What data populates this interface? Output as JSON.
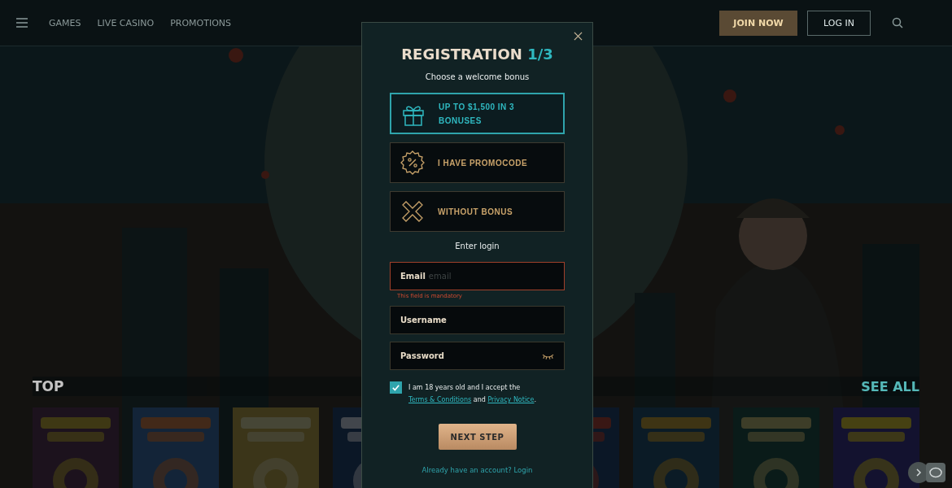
{
  "header": {
    "nav": [
      "GAMES",
      "LIVE CASINO",
      "PROMOTIONS"
    ],
    "join_button": "JOIN NOW",
    "login_button": "LOG IN"
  },
  "top_section": {
    "title": "TOP",
    "see_all": "SEE ALL"
  },
  "modal": {
    "title": "REGISTRATION",
    "step": "1/3",
    "subtitle": "Choose a welcome bonus",
    "bonus_options": [
      {
        "kind": "gift",
        "label": "UP TO $1,500 IN 3 BONUSES",
        "selected": true
      },
      {
        "kind": "percent",
        "label": "I HAVE PROMOCODE",
        "selected": false
      },
      {
        "kind": "none",
        "label": "WITHOUT BONUS",
        "selected": false
      }
    ],
    "login_heading": "Enter login",
    "fields": [
      {
        "kind": "text",
        "label": "Email",
        "placeholder": "email",
        "error": "This field is mandatory"
      },
      {
        "kind": "text",
        "label": "Username"
      },
      {
        "kind": "password",
        "label": "Password"
      }
    ],
    "consent": {
      "checked": true,
      "text": "I am 18 years old and I accept the",
      "link_terms": "Terms & Conditions",
      "joiner": "and",
      "link_privacy": "Privacy Notice",
      "end": "."
    },
    "next_button": "NEXT STEP",
    "login_link": "Already have an account? Login"
  }
}
